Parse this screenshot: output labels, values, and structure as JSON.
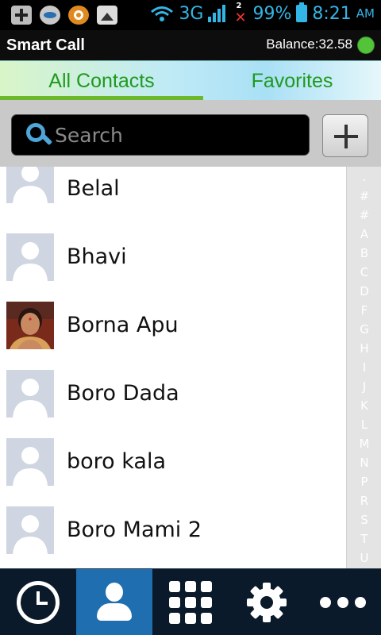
{
  "status_bar": {
    "network": "3G",
    "sim2_badge": "2",
    "battery": "99%",
    "time": "8:21",
    "ampm": "AM"
  },
  "header": {
    "title": "Smart Call",
    "balance": "Balance:32.58"
  },
  "tabs": {
    "all_contacts": "All Contacts",
    "favorites": "Favorites"
  },
  "search": {
    "placeholder": "Search"
  },
  "contacts": [
    {
      "name": "Belal",
      "has_photo": false
    },
    {
      "name": "Bhavi",
      "has_photo": false
    },
    {
      "name": "Borna Apu",
      "has_photo": true
    },
    {
      "name": "Boro Dada",
      "has_photo": false
    },
    {
      "name": "boro kala",
      "has_photo": false
    },
    {
      "name": "Boro Mami 2",
      "has_photo": false
    }
  ],
  "index_letters": [
    ".",
    "#",
    "#",
    "A",
    "B",
    "C",
    "D",
    "F",
    "G",
    "H",
    "I",
    "J",
    "K",
    "L",
    "M",
    "N",
    "P",
    "R",
    "S",
    "T",
    "U"
  ],
  "bottom_nav": [
    {
      "icon": "clock-icon",
      "active": false
    },
    {
      "icon": "person-icon",
      "active": true
    },
    {
      "icon": "dialpad-icon",
      "active": false
    },
    {
      "icon": "gear-icon",
      "active": false
    },
    {
      "icon": "more-dots-icon",
      "active": false
    }
  ],
  "colors": {
    "accent_green": "#1f9a1f",
    "active_nav": "#1f6fb0",
    "status_blue": "#33b5e5",
    "online": "#53c33a"
  }
}
